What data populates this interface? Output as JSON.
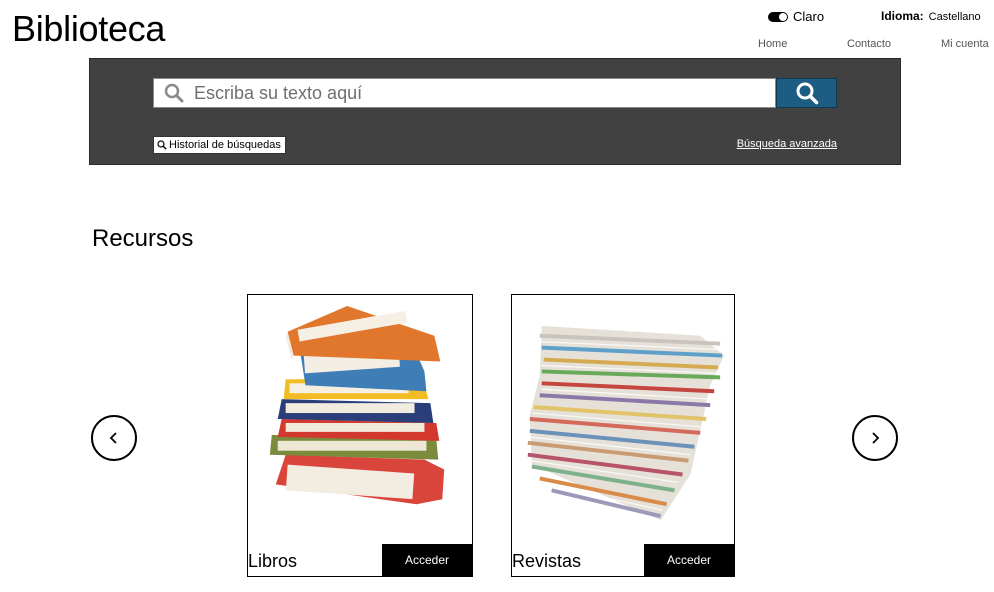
{
  "header": {
    "site_title": "Biblioteca",
    "theme_label": "Claro",
    "language_label": "Idioma:",
    "language_value": "Castellano"
  },
  "nav": {
    "items": [
      {
        "label": "Home"
      },
      {
        "label": "Contacto"
      },
      {
        "label": "Mi cuenta"
      }
    ]
  },
  "search": {
    "placeholder": "Escriba su texto aquí",
    "value": "",
    "history_label": "Historial de búsquedas",
    "advanced_label": "Búsqueda avanzada",
    "button_color": "#1d5d83",
    "panel_color": "#414141"
  },
  "resources": {
    "title": "Recursos",
    "cards": [
      {
        "label": "Libros",
        "button_label": "Acceder",
        "image": "stack-of-books"
      },
      {
        "label": "Revistas",
        "button_label": "Acceder",
        "image": "stack-of-magazines"
      }
    ]
  }
}
